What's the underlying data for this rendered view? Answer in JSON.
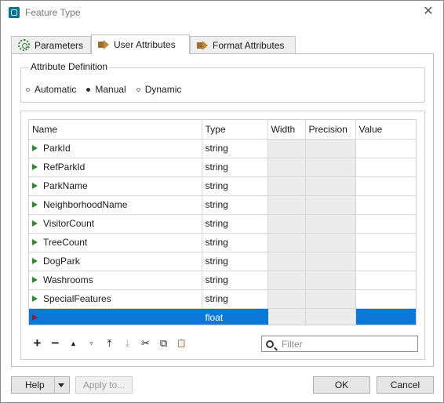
{
  "window": {
    "title": "Feature Type",
    "close_glyph": "✕"
  },
  "tabs": [
    {
      "label": "Parameters",
      "icon": "gear-icon"
    },
    {
      "label": "User Attributes",
      "icon": "arrow-icon",
      "active": true
    },
    {
      "label": "Format Attributes",
      "icon": "arrow-icon"
    }
  ],
  "attribute_definition": {
    "legend": "Attribute Definition",
    "options": [
      "Automatic",
      "Manual",
      "Dynamic"
    ],
    "selected": "Manual"
  },
  "grid": {
    "columns": [
      "Name",
      "Type",
      "Width",
      "Precision",
      "Value"
    ],
    "rows": [
      {
        "name": "ParkId",
        "type": "string",
        "width": "",
        "precision": "",
        "value": ""
      },
      {
        "name": "RefParkId",
        "type": "string",
        "width": "",
        "precision": "",
        "value": ""
      },
      {
        "name": "ParkName",
        "type": "string",
        "width": "",
        "precision": "",
        "value": ""
      },
      {
        "name": "NeighborhoodName",
        "type": "string",
        "width": "",
        "precision": "",
        "value": ""
      },
      {
        "name": "VisitorCount",
        "type": "string",
        "width": "",
        "precision": "",
        "value": ""
      },
      {
        "name": "TreeCount",
        "type": "string",
        "width": "",
        "precision": "",
        "value": ""
      },
      {
        "name": "DogPark",
        "type": "string",
        "width": "",
        "precision": "",
        "value": ""
      },
      {
        "name": "Washrooms",
        "type": "string",
        "width": "",
        "precision": "",
        "value": ""
      },
      {
        "name": "SpecialFeatures",
        "type": "string",
        "width": "",
        "precision": "",
        "value": ""
      },
      {
        "name": "",
        "type": "float",
        "width": "",
        "precision": "",
        "value": "",
        "selected": true
      }
    ]
  },
  "toolbar": {
    "plus": "+",
    "minus": "−",
    "up": "▲",
    "down": "▼",
    "top": "⤒",
    "bottom": "⤓",
    "cut": "✂",
    "copy": "⧉",
    "paste": "📋"
  },
  "filter": {
    "placeholder": "Filter",
    "value": ""
  },
  "buttons": {
    "help": "Help",
    "apply": "Apply to...",
    "ok": "OK",
    "cancel": "Cancel"
  },
  "colors": {
    "selection": "#0b78d7",
    "attr_arrow": "#2f8a2f",
    "new_attr_arrow": "#8f1f2f"
  }
}
